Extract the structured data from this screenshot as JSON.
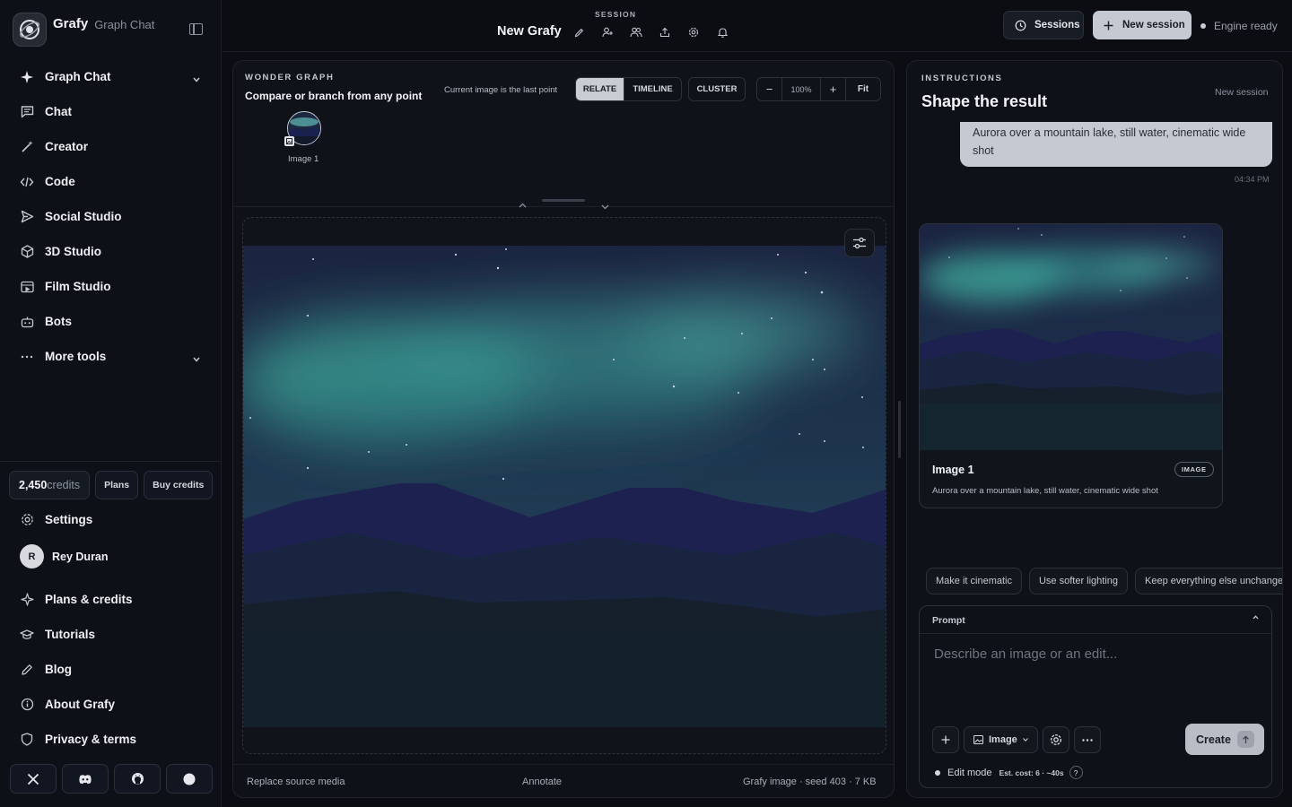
{
  "brand": {
    "name": "Grafy",
    "subtitle": "Graph Chat"
  },
  "sidebar": {
    "items": [
      {
        "label": "Graph Chat",
        "icon": "sparkle-icon"
      },
      {
        "label": "Chat",
        "icon": "message-icon"
      },
      {
        "label": "Creator",
        "icon": "wand-icon"
      },
      {
        "label": "Code",
        "icon": "code-icon"
      },
      {
        "label": "Social Studio",
        "icon": "send-icon"
      },
      {
        "label": "3D Studio",
        "icon": "cube-icon"
      },
      {
        "label": "Film Studio",
        "icon": "film-icon"
      },
      {
        "label": "Bots",
        "icon": "bot-icon"
      },
      {
        "label": "More tools",
        "icon": "ellipsis-icon"
      }
    ],
    "credits": {
      "amount": "2,450",
      "unit": "credits",
      "plans_label": "Plans",
      "buy_label": "Buy credits"
    },
    "settings_label": "Settings",
    "user": {
      "initial": "R",
      "name": "Rey Duran"
    },
    "lower_items": [
      {
        "label": "Plans & credits",
        "icon": "sparkle-outline-icon"
      },
      {
        "label": "Tutorials",
        "icon": "graduation-cap-icon"
      },
      {
        "label": "Blog",
        "icon": "pencil-icon"
      },
      {
        "label": "About Grafy",
        "icon": "info-icon"
      },
      {
        "label": "Privacy & terms",
        "icon": "shield-icon"
      }
    ],
    "social": [
      "x-icon",
      "discord-icon",
      "github-icon",
      "circle-icon"
    ]
  },
  "topbar": {
    "session_label": "SESSION",
    "session_title": "New Grafy",
    "sessions_label": "Sessions",
    "new_session_label": "New session",
    "engine_status": "Engine ready"
  },
  "graph": {
    "label": "WONDER GRAPH",
    "subtitle": "Compare or branch from any point",
    "note": "Current image is the last point",
    "modes": [
      "RELATE",
      "TIMELINE",
      "CLUSTER"
    ],
    "active_mode": "RELATE",
    "zoom": "100%",
    "fit_label": "Fit",
    "node_label": "Image 1"
  },
  "canvas_footer": {
    "replace": "Replace source media",
    "annotate": "Annotate",
    "info": "Grafy image · seed 403 · 7 KB"
  },
  "instructions": {
    "label": "INSTRUCTIONS",
    "title": "Shape the result",
    "new_session": "New session",
    "message": "Aurora over a mountain lake, still water, cinematic wide shot",
    "time": "04:34 PM",
    "card": {
      "title": "Image 1",
      "badge": "IMAGE",
      "caption": "Aurora over a mountain lake, still water, cinematic wide shot"
    },
    "chips": [
      "Make it cinematic",
      "Use softer lighting",
      "Keep everything else unchanged"
    ],
    "prompt": {
      "label": "Prompt",
      "placeholder": "Describe an image or an edit...",
      "type_label": "Image",
      "create_label": "Create",
      "mode_label": "Edit mode",
      "cost": "Est. cost: 6 · ~40s"
    }
  },
  "colors": {
    "bg": "#0b0d12",
    "panel": "#0e1117",
    "accent": "#c5c9d1",
    "aurora": "#3fa79a"
  }
}
